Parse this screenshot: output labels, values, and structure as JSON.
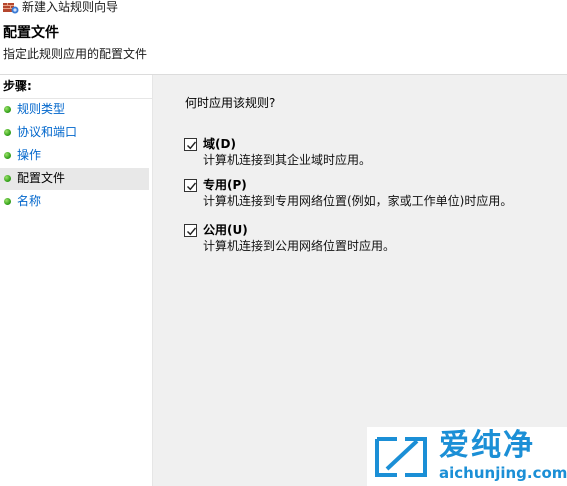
{
  "window": {
    "title": "新建入站规则向导",
    "icon": "firewall-wizard-icon"
  },
  "header": {
    "title": "配置文件",
    "subtitle": "指定此规则应用的配置文件"
  },
  "sidebar": {
    "heading": "步骤:",
    "items": [
      {
        "label": "规则类型",
        "current": false
      },
      {
        "label": "协议和端口",
        "current": false
      },
      {
        "label": "操作",
        "current": false
      },
      {
        "label": "配置文件",
        "current": true
      },
      {
        "label": "名称",
        "current": false
      }
    ]
  },
  "main": {
    "question": "何时应用该规则?",
    "options": [
      {
        "label": "域(D)",
        "description": "计算机连接到其企业域时应用。",
        "checked": true
      },
      {
        "label": "专用(P)",
        "description": "计算机连接到专用网络位置(例如，家或工作单位)时应用。",
        "checked": true
      },
      {
        "label": "公用(U)",
        "description": "计算机连接到公用网络位置时应用。",
        "checked": true
      }
    ]
  },
  "watermark": {
    "brand": "爱纯净",
    "url": "aichunjing.com"
  },
  "colors": {
    "link": "#0066cc",
    "panel": "#f0f0f0",
    "selected_step": "#e8e8e8",
    "watermark": "#1b8fd6"
  }
}
